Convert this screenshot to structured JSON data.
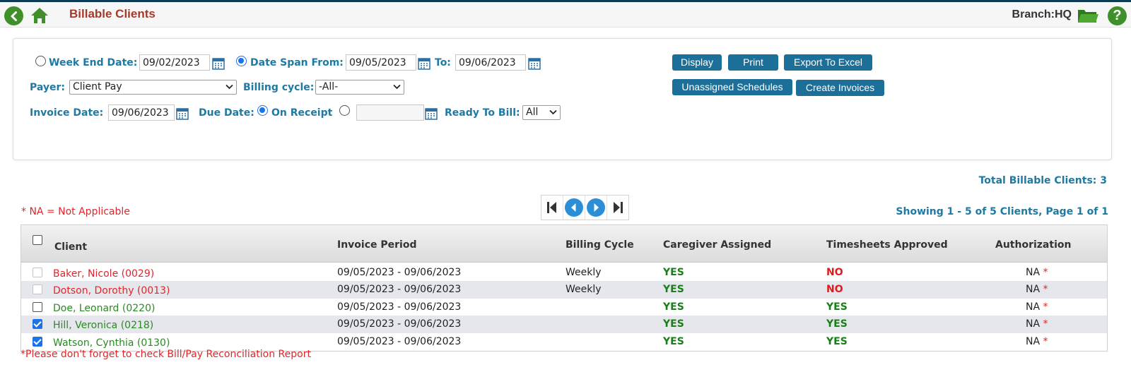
{
  "header": {
    "title": "Billable Clients",
    "branch": "Branch:HQ",
    "help_glyph": "?"
  },
  "filters": {
    "week_end_label": "Week End Date:",
    "week_end_value": "09/02/2023",
    "week_end_selected": false,
    "date_span_label": "Date Span From:",
    "date_span_selected": true,
    "date_from": "09/05/2023",
    "to_label": "To:",
    "date_to": "09/06/2023",
    "payer_label": "Payer:",
    "payer_value": "Client Pay",
    "billing_cycle_label": "Billing cycle:",
    "billing_cycle_value": "-All-",
    "invoice_date_label": "Invoice Date:",
    "invoice_date_value": "09/06/2023",
    "due_date_label": "Due Date:",
    "on_receipt_label": "On Receipt",
    "on_receipt_selected": true,
    "due_custom_value": "",
    "ready_to_bill_label": "Ready To Bill:",
    "ready_to_bill_value": "All"
  },
  "actions": {
    "display": "Display",
    "print": "Print",
    "export": "Export To Excel",
    "unassigned": "Unassigned Schedules",
    "create_invoices": "Create Invoices"
  },
  "summary": {
    "total_label": "Total Billable Clients:  3",
    "na_note": "* NA = Not Applicable",
    "showing": "Showing 1 - 5 of 5 Clients, Page 1 of 1"
  },
  "table": {
    "headers": {
      "client": "Client",
      "invoice_period": "Invoice Period",
      "billing_cycle": "Billing Cycle",
      "caregiver": "Caregiver Assigned",
      "timesheets": "Timesheets Approved",
      "authorization": "Authorization"
    },
    "rows": [
      {
        "client": "Baker, Nicole (0029)",
        "period": "09/05/2023 - 09/06/2023",
        "cycle": "Weekly",
        "caregiver": "YES",
        "timesheets": "NO",
        "auth": "NA",
        "auth_mark": "*"
      },
      {
        "client": "Dotson, Dorothy (0013)",
        "period": "09/05/2023 - 09/06/2023",
        "cycle": "Weekly",
        "caregiver": "YES",
        "timesheets": "NO",
        "auth": "NA",
        "auth_mark": "*"
      },
      {
        "client": "Doe, Leonard (0220)",
        "period": "09/05/2023 - 09/06/2023",
        "cycle": "",
        "caregiver": "YES",
        "timesheets": "YES",
        "auth": "NA",
        "auth_mark": "*"
      },
      {
        "client": "Hill, Veronica (0218)",
        "period": "09/05/2023 - 09/06/2023",
        "cycle": "",
        "caregiver": "YES",
        "timesheets": "YES",
        "auth": "NA",
        "auth_mark": "*"
      },
      {
        "client": "Watson, Cynthia (0130)",
        "period": "09/05/2023 - 09/06/2023",
        "cycle": "",
        "caregiver": "YES",
        "timesheets": "YES",
        "auth": "NA",
        "auth_mark": "*"
      }
    ]
  },
  "footer_note": "*Please don't forget to check Bill/Pay Reconciliation Report",
  "colors": {
    "accent_blue": "#1f7aa3",
    "button_blue": "#1c6f98",
    "title_red": "#a63a2a",
    "alert_red": "#e0262a",
    "ok_green": "#188018",
    "icon_green": "#3f8f2a"
  }
}
